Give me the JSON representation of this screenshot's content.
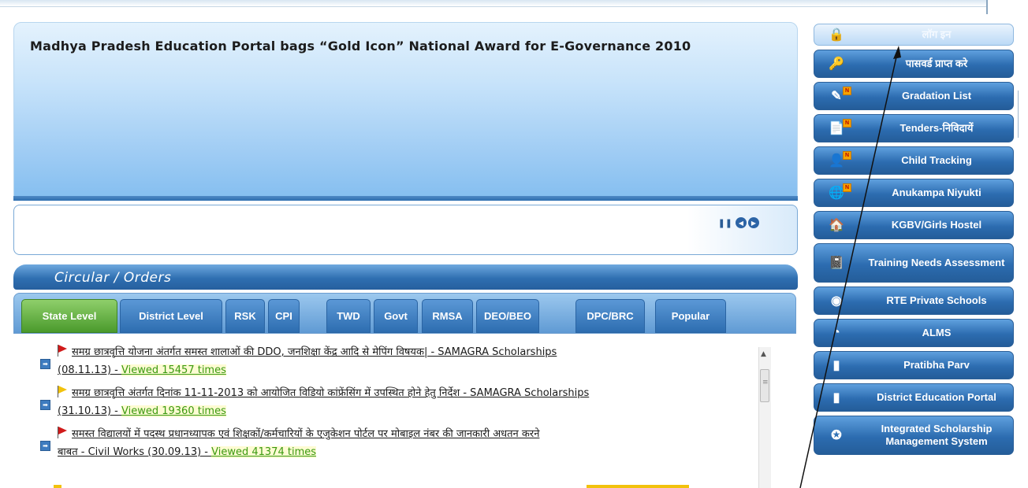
{
  "banner": {
    "title": "Madhya Pradesh Education Portal bags “Gold Icon” National Award for E-Governance 2010"
  },
  "circulars": {
    "title": "Circular / Orders",
    "tabs": [
      "State Level",
      "District Level",
      "RSK",
      "CPI",
      "TWD",
      "Govt",
      "RMSA",
      "DEO/BEO",
      "DPC/BRC",
      "Popular"
    ],
    "active_tab": "State Level",
    "items": [
      {
        "flag": "red",
        "text_line1": "समग्र छात्रवृत्ति योजना अंतर्गत समस्त शालाओं की DDO, जनशिक्षा केंद्र आदि से मेपिंग विषयक| - SAMAGRA Scholarships",
        "text_line2": "(08.11.13) - ",
        "views": "Viewed 15457 times"
      },
      {
        "flag": "yellow",
        "text_line1": "समग्र छात्रवृत्ति अंतर्गत दिनांक 11-11-2013 को आयोजित विडियो कांफ्रेंसिंग में उपस्थित होने हेतु निर्देश - SAMAGRA Scholarships",
        "text_line2": "(31.10.13) - ",
        "views": "Viewed 19360 times"
      },
      {
        "flag": "red",
        "text_line1": "समस्त विद्यालयों में पदस्थ प्रधानध्यापक एवं शिक्षकों/कर्मचारियों के एजुकेशन पोर्टल पर मोबाइल नंबर की जानकारी अधतन करने",
        "text_line2": "बाबत - Civil Works (30.09.13) - ",
        "views": "Viewed 41374 times"
      }
    ]
  },
  "sidebar": {
    "items": [
      {
        "label": "लॉग इन",
        "icon": "lock-icon",
        "glyph": "🔒",
        "badge": false,
        "height": 28
      },
      {
        "label": "पासवर्ड प्राप्त करे",
        "icon": "key-icon",
        "glyph": "🔑",
        "badge": false,
        "height": 36
      },
      {
        "label": "Gradation List",
        "icon": "pencil-icon",
        "glyph": "✎",
        "badge": true,
        "height": 36
      },
      {
        "label": "Tenders-निविदायें",
        "icon": "document-icon",
        "glyph": "📄",
        "badge": true,
        "height": 36
      },
      {
        "label": "Child Tracking",
        "icon": "child-icon",
        "glyph": "👤",
        "badge": true,
        "height": 36
      },
      {
        "label": "Anukampa Niyukti",
        "icon": "globe-icon",
        "glyph": "🌐",
        "badge": true,
        "height": 36
      },
      {
        "label": "KGBV/Girls Hostel",
        "icon": "hostel-icon",
        "glyph": "🏠",
        "badge": false,
        "height": 36
      },
      {
        "label": "Training Needs Assessment",
        "icon": "notebook-icon",
        "glyph": "📓",
        "badge": false,
        "height": 50
      },
      {
        "label": "RTE Private Schools",
        "icon": "disc-icon",
        "glyph": "◉",
        "badge": false,
        "height": 36
      },
      {
        "label": "ALMS",
        "icon": "chart-pie-icon",
        "glyph": "◔",
        "badge": false,
        "height": 36
      },
      {
        "label": "Pratibha Parv",
        "icon": "bar-chart-icon",
        "glyph": "▮",
        "badge": false,
        "height": 36
      },
      {
        "label": "District Education Portal",
        "icon": "bar-chart-icon",
        "glyph": "▮",
        "badge": false,
        "height": 36
      },
      {
        "label": "Integrated Scholarship Management System",
        "icon": "emblem-icon",
        "glyph": "✪",
        "badge": false,
        "height": 50
      }
    ]
  },
  "news_controls": {
    "pause": "❚❚",
    "prev": "◀",
    "next": "▶"
  },
  "colors": {
    "accent": "#2c6cb0",
    "active_tab": "#4a9a2c",
    "viewed": "#3a9a11"
  }
}
